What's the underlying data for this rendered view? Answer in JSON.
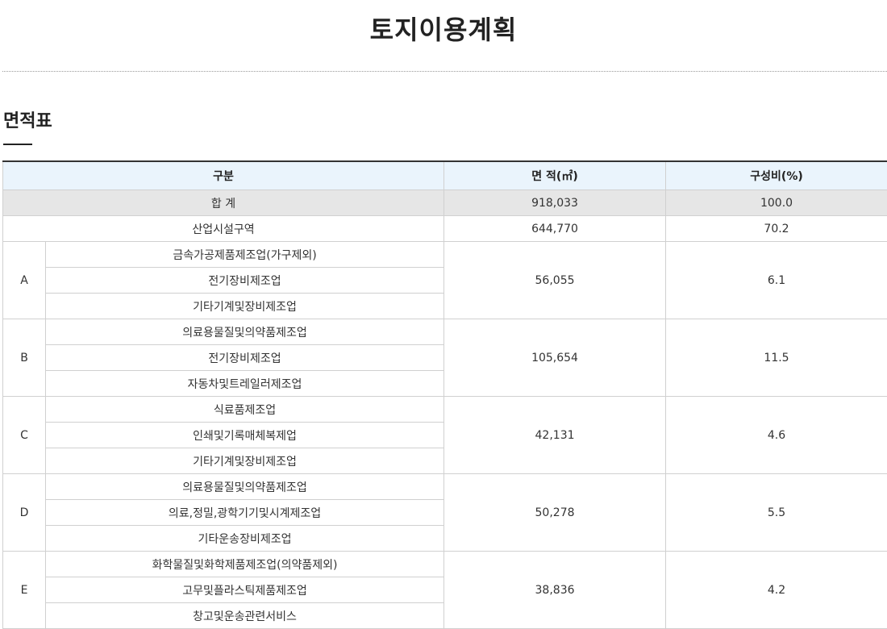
{
  "page_title": "토지이용계획",
  "section_title": "면적표",
  "table": {
    "headers": [
      "구분",
      "면 적(㎡)",
      "구성비(%)"
    ],
    "total": {
      "label": "합 계",
      "area": "918,033",
      "ratio": "100.0"
    },
    "zone": {
      "label": "산업시설구역",
      "area": "644,770",
      "ratio": "70.2"
    },
    "groups": [
      {
        "code": "A",
        "items": [
          "금속가공제품제조업(가구제외)",
          "전기장비제조업",
          "기타기계및장비제조업"
        ],
        "area": "56,055",
        "ratio": "6.1"
      },
      {
        "code": "B",
        "items": [
          "의료용물질및의약품제조업",
          "전기장비제조업",
          "자동차및트레일러제조업"
        ],
        "area": "105,654",
        "ratio": "11.5"
      },
      {
        "code": "C",
        "items": [
          "식료품제조업",
          "인쇄및기록매체복제업",
          "기타기계및장비제조업"
        ],
        "area": "42,131",
        "ratio": "4.6"
      },
      {
        "code": "D",
        "items": [
          "의료용물질및의약품제조업",
          "의료,정밀,광학기기및시계제조업",
          "기타운송장비제조업"
        ],
        "area": "50,278",
        "ratio": "5.5"
      },
      {
        "code": "E",
        "items": [
          "화학물질및화학제품제조업(의약품제외)",
          "고무및플라스틱제품제조업",
          "창고및운송관련서비스"
        ],
        "area": "38,836",
        "ratio": "4.2"
      }
    ]
  }
}
